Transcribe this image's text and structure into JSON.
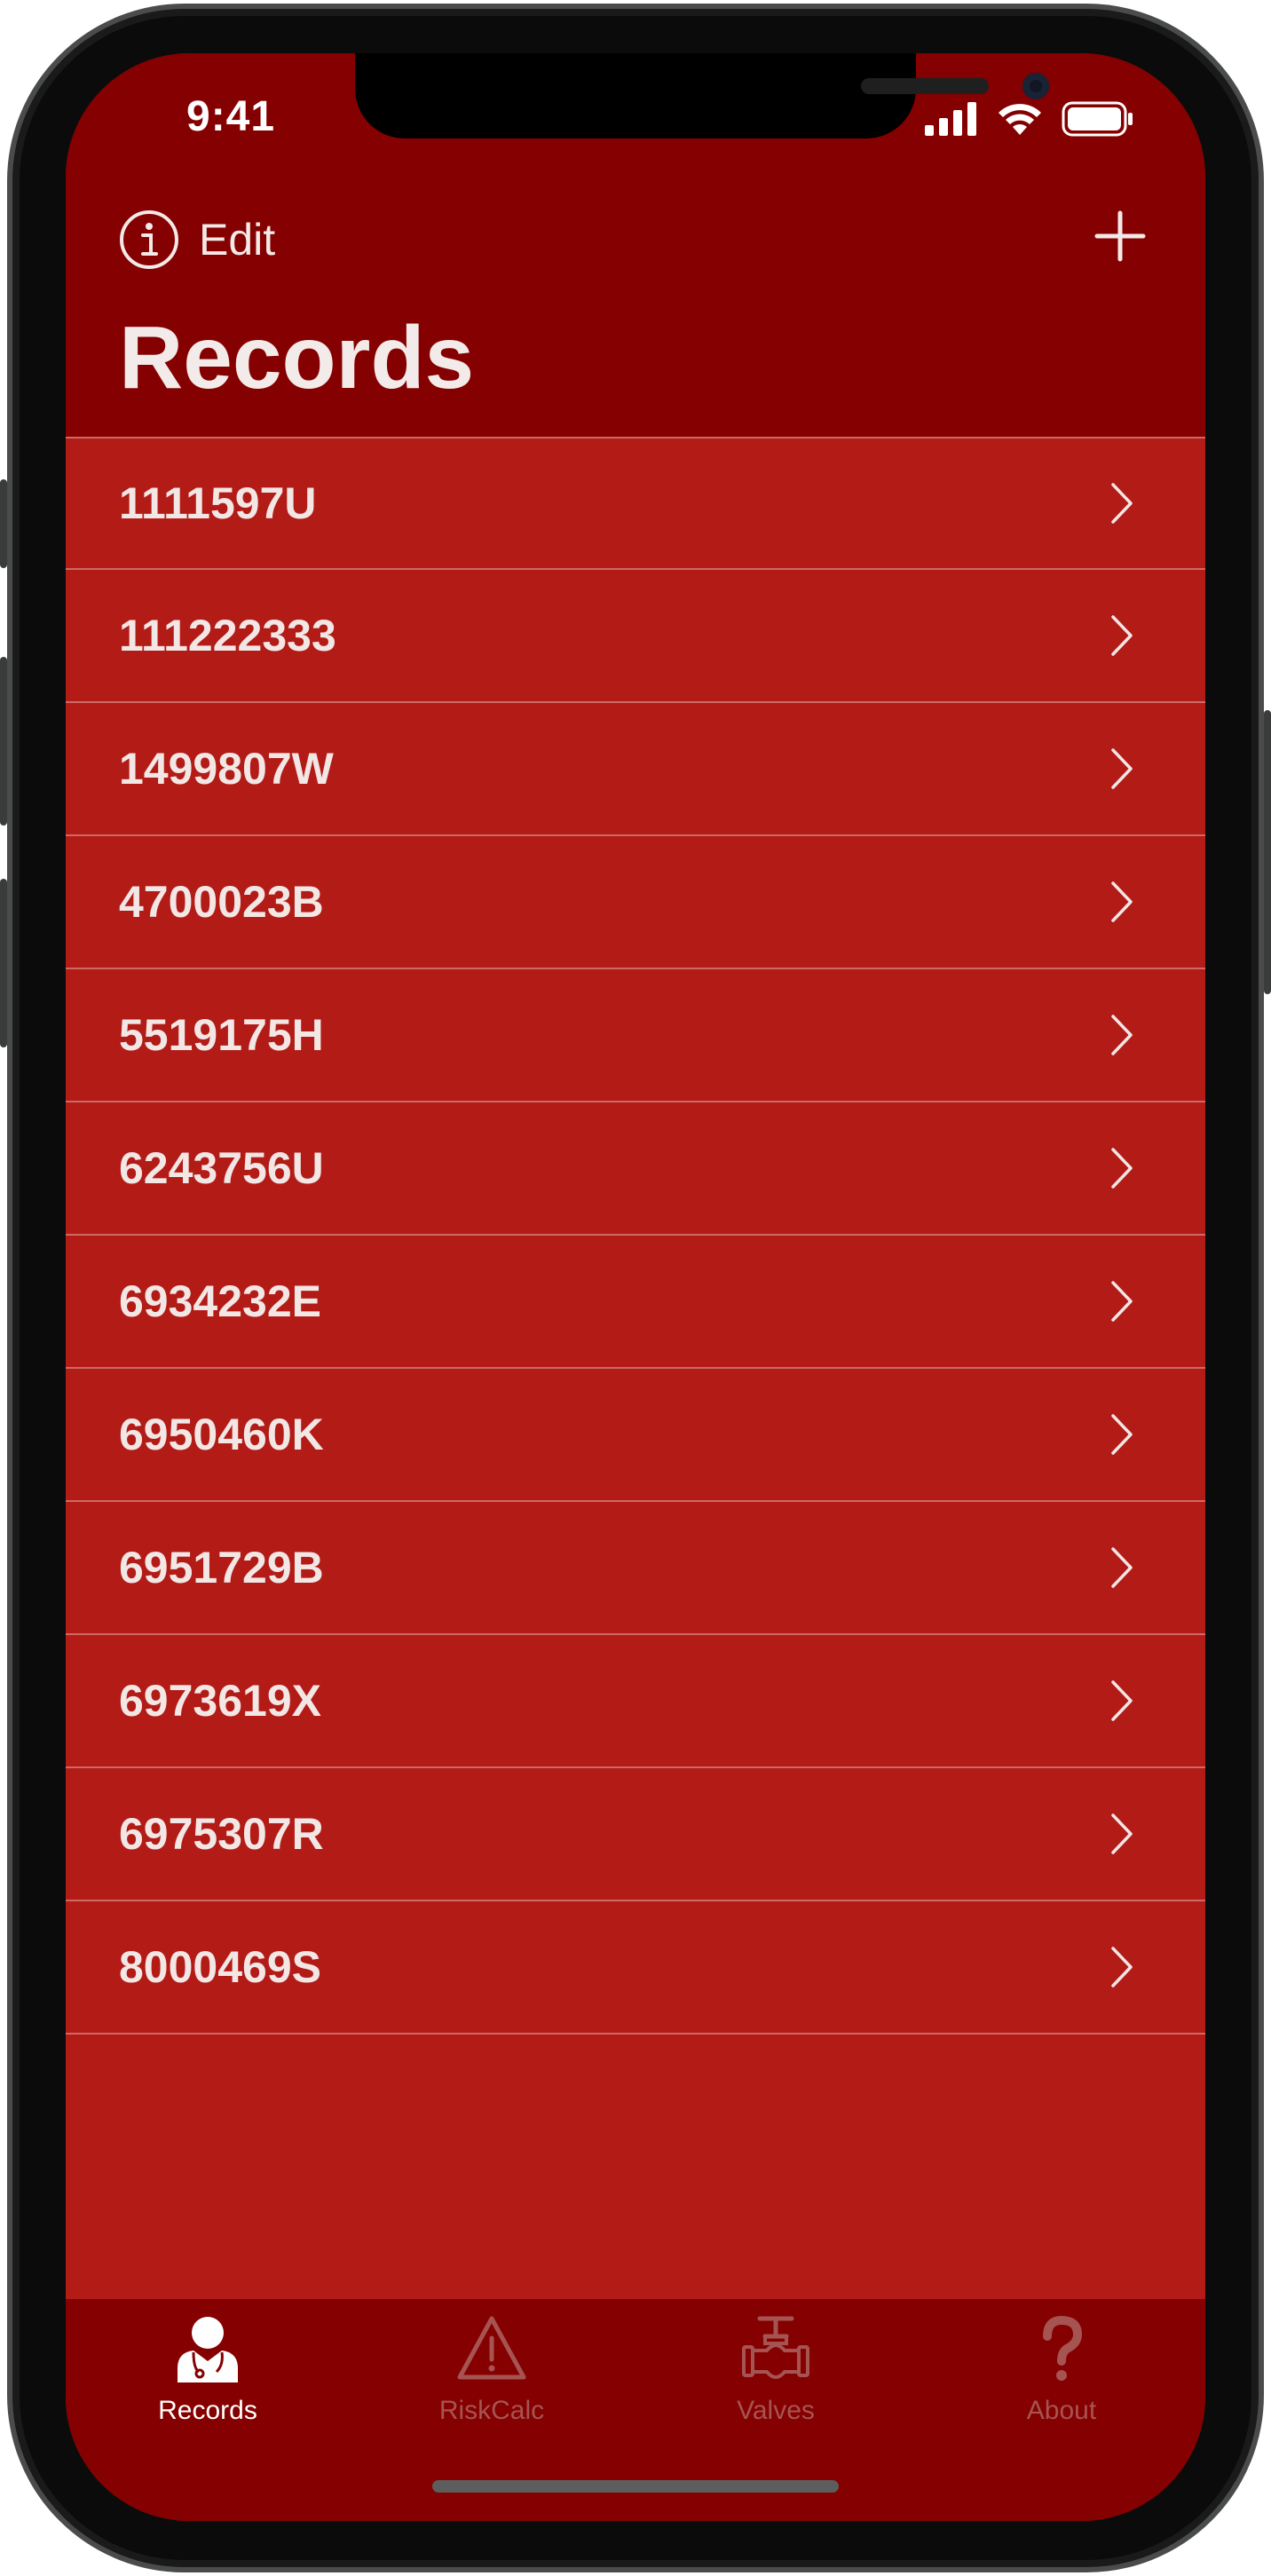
{
  "status_bar": {
    "time": "9:41"
  },
  "nav": {
    "edit_label": "Edit",
    "title": "Records"
  },
  "records": [
    {
      "id": "1111597U"
    },
    {
      "id": "111222333"
    },
    {
      "id": "1499807W"
    },
    {
      "id": "4700023B"
    },
    {
      "id": "5519175H"
    },
    {
      "id": "6243756U"
    },
    {
      "id": "6934232E"
    },
    {
      "id": "6950460K"
    },
    {
      "id": "6951729B"
    },
    {
      "id": "6973619X"
    },
    {
      "id": "6975307R"
    },
    {
      "id": "8000469S"
    }
  ],
  "tabs": [
    {
      "label": "Records",
      "icon": "doctor-icon",
      "active": true
    },
    {
      "label": "RiskCalc",
      "icon": "warning-icon",
      "active": false
    },
    {
      "label": "Valves",
      "icon": "valve-icon",
      "active": false
    },
    {
      "label": "About",
      "icon": "question-icon",
      "active": false
    }
  ],
  "colors": {
    "header": "#850000",
    "list_background": "#b31b17",
    "text": "#f3ebe9",
    "tab_inactive": "#a65452"
  }
}
